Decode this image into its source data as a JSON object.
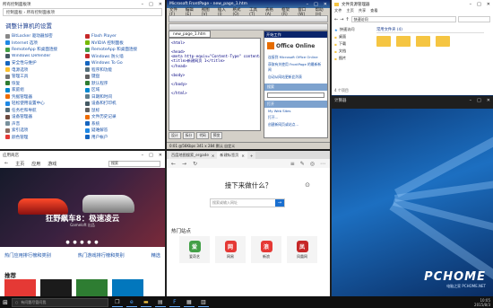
{
  "control_panel": {
    "title": "所有控制面板项",
    "address": "控制面板 › 所有控制面板项",
    "heading": "调整计算机的设置",
    "items_left": [
      {
        "label": "BitLocker 驱动器加密",
        "color": "#888888"
      },
      {
        "label": "Internet 选项",
        "color": "#1e88e5"
      },
      {
        "label": "RemoteApp 和桌面连接",
        "color": "#43a047"
      },
      {
        "label": "Windows Defender",
        "color": "#455a64"
      },
      {
        "label": "安全性与维护",
        "color": "#1565c0"
      },
      {
        "label": "电源选项",
        "color": "#fbc02d"
      },
      {
        "label": "管理工具",
        "color": "#757575"
      },
      {
        "label": "恢复",
        "color": "#2e7d32"
      },
      {
        "label": "家庭组",
        "color": "#0288d1"
      },
      {
        "label": "凭据管理器",
        "color": "#ef6c00"
      },
      {
        "label": "轻松使用设置中心",
        "color": "#1e88e5"
      },
      {
        "label": "任务栏和导航",
        "color": "#546e7a"
      },
      {
        "label": "设备管理器",
        "color": "#6d4c41"
      },
      {
        "label": "声音",
        "color": "#78909c"
      },
      {
        "label": "索引选项",
        "color": "#8d6e63"
      },
      {
        "label": "颜色管理",
        "color": "#e53935"
      }
    ],
    "items_right": [
      {
        "label": "Flash Player",
        "color": "#c62828"
      },
      {
        "label": "NVIDIA 控制面板",
        "color": "#76b900"
      },
      {
        "label": "RemoteApp 和桌面连接",
        "color": "#43a047"
      },
      {
        "label": "Windows 防火墙",
        "color": "#c62828"
      },
      {
        "label": "Windows To Go",
        "color": "#1565c0"
      },
      {
        "label": "程序和功能",
        "color": "#546e7a"
      },
      {
        "label": "键盘",
        "color": "#616161"
      },
      {
        "label": "默认程序",
        "color": "#2e7d32"
      },
      {
        "label": "区域",
        "color": "#0288d1"
      },
      {
        "label": "日期和时间",
        "color": "#607d8b"
      },
      {
        "label": "设备和打印机",
        "color": "#455a64"
      },
      {
        "label": "鼠标",
        "color": "#616161"
      },
      {
        "label": "文件历史记录",
        "color": "#ef6c00"
      },
      {
        "label": "系统",
        "color": "#1565c0"
      },
      {
        "label": "疑难解答",
        "color": "#1e88e5"
      },
      {
        "label": "用户帐户",
        "color": "#1565c0"
      }
    ]
  },
  "frontpage": {
    "title": "Microsoft FrontPage - new_page_1.htm",
    "menus": [
      "文件(F)",
      "编辑(E)",
      "视图(V)",
      "插入(I)",
      "格式(O)",
      "工具(T)",
      "表格(A)",
      "框架(R)",
      "窗口(W)",
      "帮助(H)"
    ],
    "doc_tab": "new_page_1.htm",
    "code": "<html>\n\n<head>\n<meta http-equiv=\"Content-Type\" content=\"te\n<title>新建网页 1</title>\n</head>\n\n<body>\n\n</body>\n\n</html>",
    "pane_title": "开始工作",
    "pane_logo": "Office Online",
    "pane_links": [
      "连接到 Microsoft Office Online",
      "获取有关使用 FrontPage 的最新新闻",
      "自动从网站更新此列表"
    ],
    "pane_section1": "搜索",
    "pane_section2": "打开",
    "pane_files": [
      "My Web Sites",
      "打开..."
    ],
    "pane_new": "创建新网页或站点...",
    "bottom_tabs": [
      "设计",
      "拆分",
      "代码",
      "预览"
    ],
    "status": "0:01 @56Kbps  341 x 284  默认  自定义"
  },
  "explorer": {
    "title": "文件资源管理器",
    "ribbon": [
      "文件",
      "主页",
      "共享",
      "查看"
    ],
    "address": "快速访问",
    "side": [
      "快速访问",
      "桌面",
      "下载",
      "文档",
      "图片"
    ],
    "main_heading": "常用文件夹 (4)",
    "status": "4 个项目"
  },
  "calculator": {
    "title": "计算器"
  },
  "desktop": {
    "watermark": "PCHOME",
    "watermark_sub": "电脑之家 PCHOME.NET"
  },
  "store": {
    "title": "应用商店",
    "nav": [
      "主页",
      "应用",
      "游戏"
    ],
    "search": "搜索",
    "hero_title": "狂野飙车8：极速凌云",
    "hero_sub": "Gameloft 出品",
    "links": [
      "热门应用排行榜和类别",
      "热门游戏排行榜和类别",
      "精选"
    ],
    "recommend": "推荐",
    "tile_colors": [
      "#e53935",
      "#1b1b1b",
      "#2e7d32",
      "#0277bd"
    ]
  },
  "edge": {
    "tabs": [
      "百度地图搜索_ergade",
      "新建标签页"
    ],
    "question": "接下来做什么？",
    "search_placeholder": "搜索或输入网址",
    "hot_sites": "热门站点",
    "sites": [
      {
        "label": "爱奇艺",
        "color": "#43a047",
        "glyph": "爱"
      },
      {
        "label": "网易",
        "color": "#e53935",
        "glyph": "网"
      },
      {
        "label": "新浪",
        "color": "#e53935",
        "glyph": "浪"
      },
      {
        "label": "凤凰网",
        "color": "#c62828",
        "glyph": "凤"
      }
    ]
  },
  "taskbar": {
    "search": "有问题尽管问我",
    "time": "10:05",
    "date": "2015/8/3"
  }
}
